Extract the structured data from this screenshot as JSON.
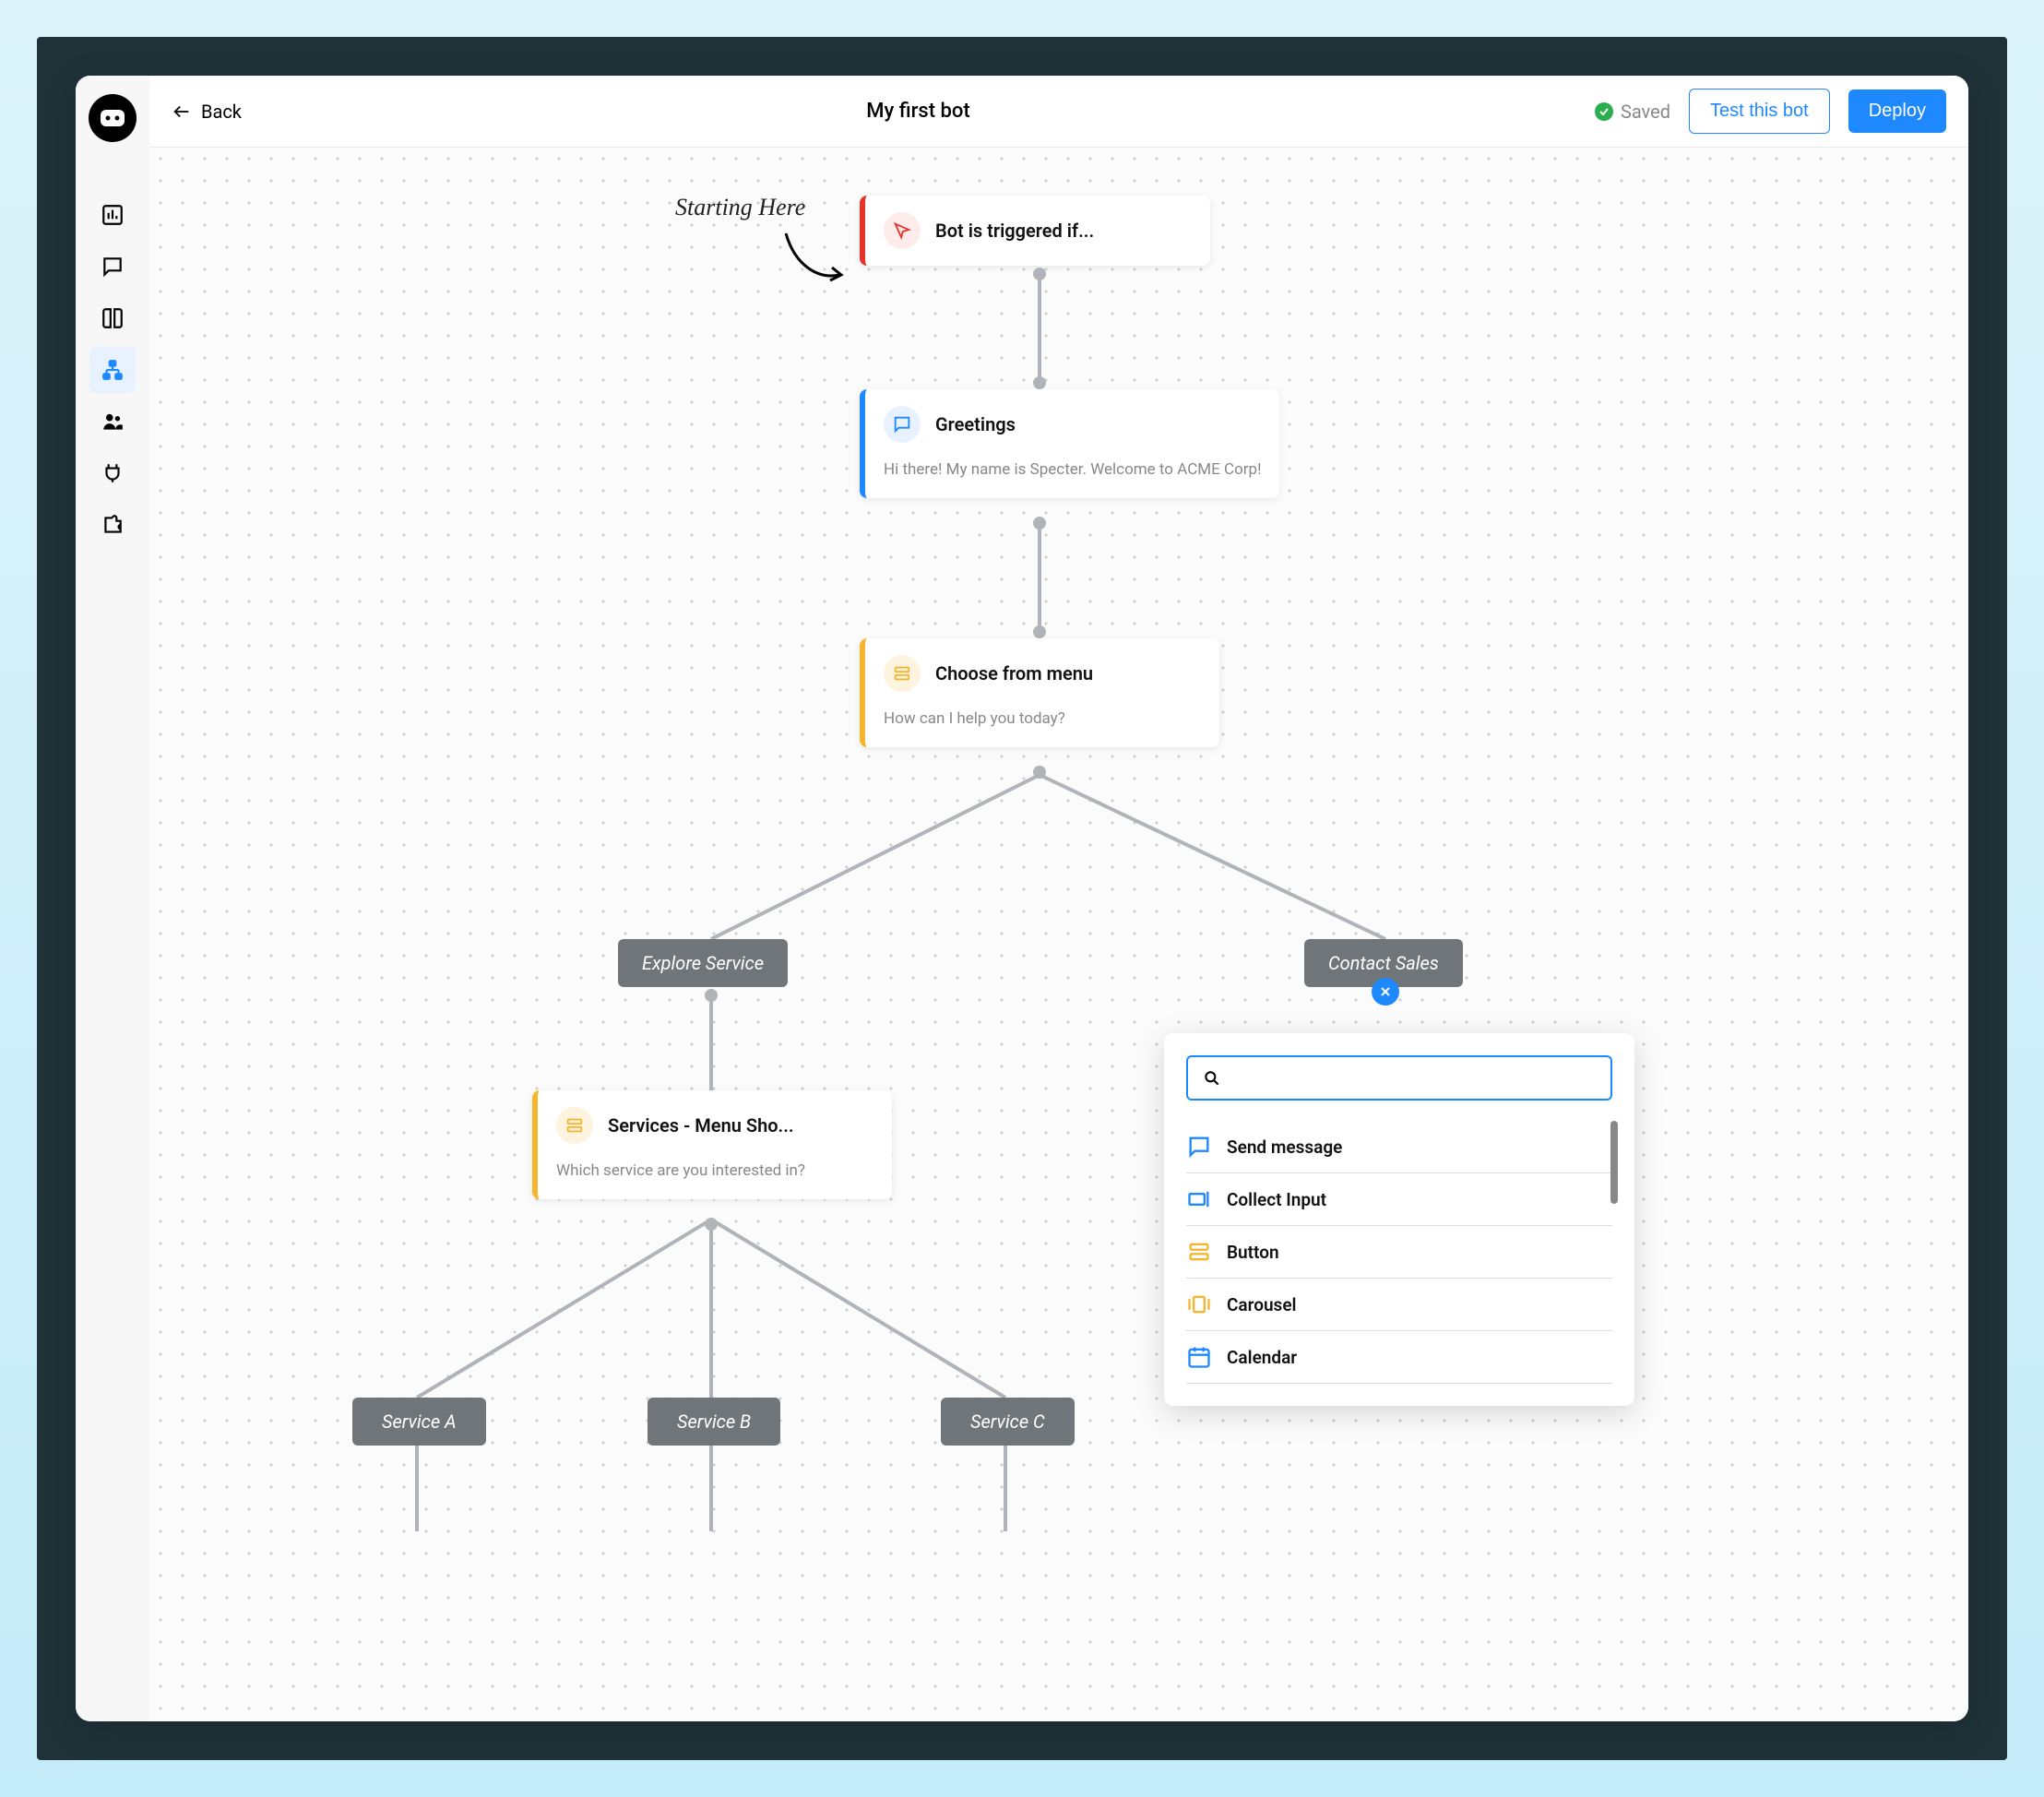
{
  "header": {
    "back_label": "Back",
    "title": "My first bot",
    "saved_label": "Saved",
    "test_button": "Test this bot",
    "deploy_button": "Deploy"
  },
  "annotation": {
    "starting": "Starting Here"
  },
  "nodes": {
    "trigger": {
      "title": "Bot is triggered if...",
      "accent": "#e5352b"
    },
    "greetings": {
      "title": "Greetings",
      "body": "Hi there! My name is Specter. Welcome to ACME Corp!",
      "accent": "#1e88ff"
    },
    "menu": {
      "title": "Choose from menu",
      "body": "How can I help you today?",
      "accent": "#f6b531"
    },
    "services_menu": {
      "title": "Services - Menu Sho...",
      "body": "Which service are you interested in?",
      "accent": "#f6b531"
    }
  },
  "branches": {
    "explore": "Explore Service",
    "contact": "Contact Sales",
    "service_a": "Service A",
    "service_b": "Service B",
    "service_c": "Service C"
  },
  "panel": {
    "search_placeholder": "",
    "items": [
      {
        "label": "Send message"
      },
      {
        "label": "Collect Input"
      },
      {
        "label": "Button"
      },
      {
        "label": "Carousel"
      },
      {
        "label": "Calendar"
      }
    ]
  }
}
